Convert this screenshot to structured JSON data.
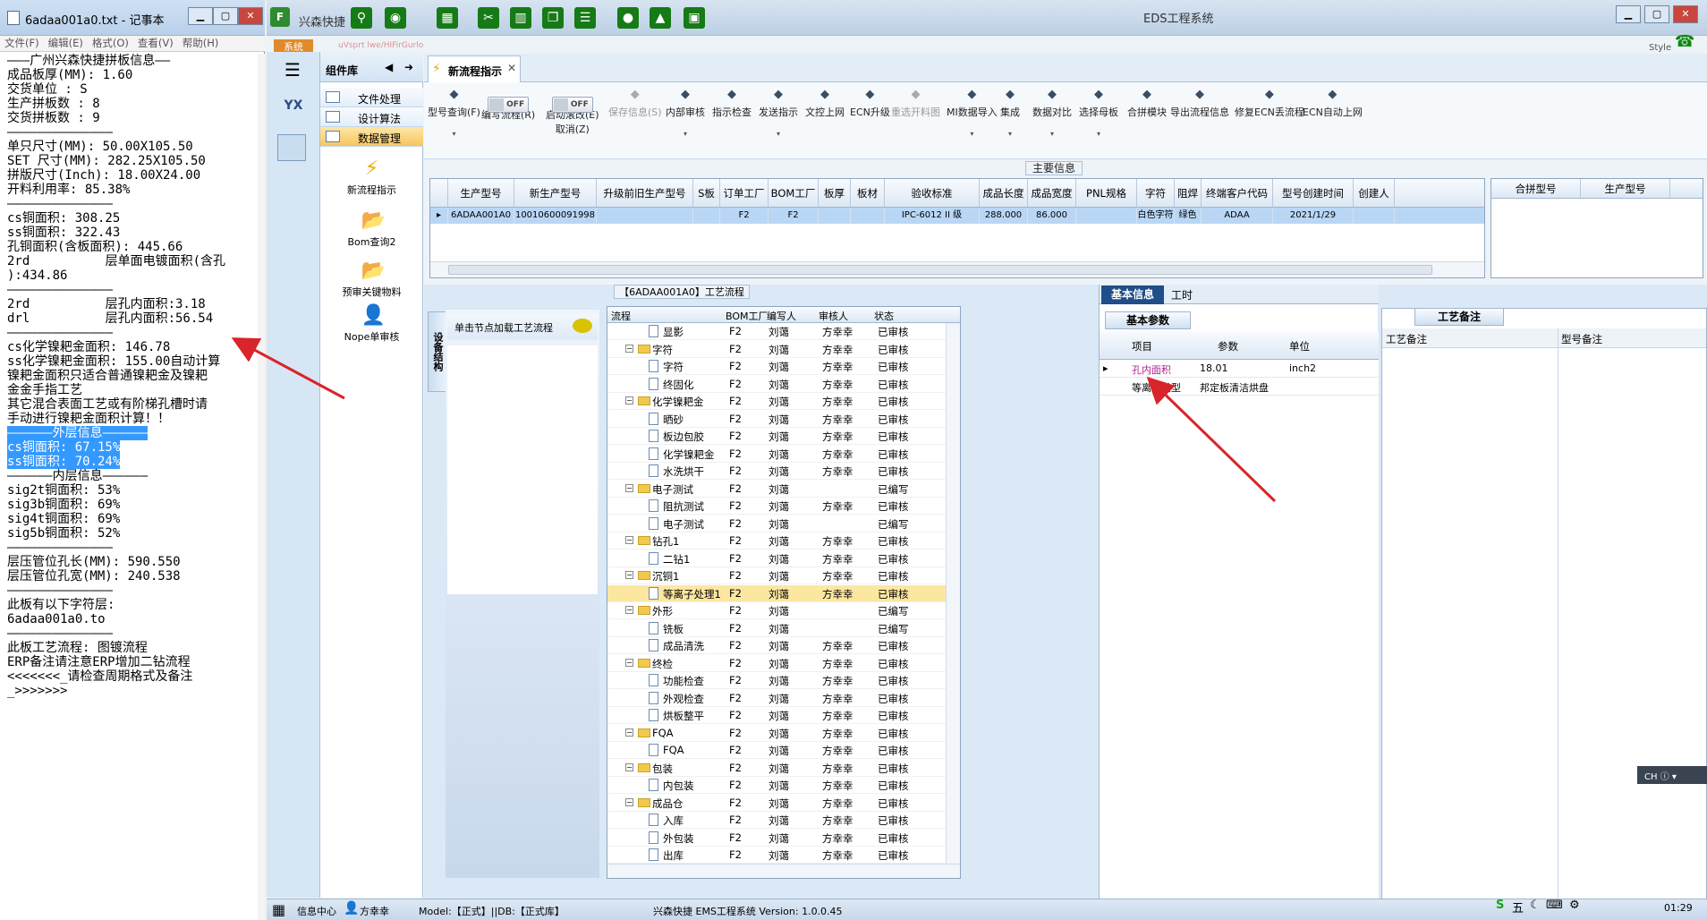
{
  "notepad": {
    "title": "6adaa001a0.txt - 记事本",
    "menu": [
      "文件(F)",
      "编辑(E)",
      "格式(O)",
      "查看(V)",
      "帮助(H)"
    ],
    "lines": [
      "———广州兴森快捷拼板信息——",
      "成品板厚(MM): 1.60",
      "交货单位 : S",
      "生产拼板数 : 8",
      "交货拼板数 : 9",
      "——————————————",
      "单只尺寸(MM): 50.00X105.50",
      "SET 尺寸(MM): 282.25X105.50",
      "拼版尺寸(Inch): 18.00X24.00",
      "开料利用率: 85.38%",
      "——————————————",
      "cs铜面积: 308.25",
      "ss铜面积: 322.43",
      "孔铜面积(含板面积): 445.66",
      "2rd          层单面电镀面积(含孔",
      "):434.86",
      "",
      "——————————————",
      "2rd          层孔内面积:3.18",
      "drl          层孔内面积:56.54",
      "",
      "——————————————",
      "cs化学镍耙金面积: 146.78",
      "ss化学镍耙金面积: 155.00自动计算",
      "镍耙金面积只适合普通镍耙金及镍耙",
      "金金手指工艺",
      "其它混合表面工艺或有阶梯孔槽时请",
      "手动进行镍耙金面积计算！！",
      "——————外层信息——————",
      "cs铜面积: 67.15%",
      "ss铜面积: 70.24%",
      "——————内层信息——————",
      "sig2t铜面积: 53%",
      "sig3b铜面积: 69%",
      "sig4t铜面积: 69%",
      "sig5b铜面积: 52%",
      "——————————————",
      "层压管位孔长(MM): 590.550",
      "层压管位孔宽(MM): 240.538",
      "",
      "——————————————",
      "此板有以下字符层:",
      "6adaa001a0.to",
      "——————————————",
      "此板工艺流程: 图镀流程",
      "ERP备注请注意ERP增加二钻流程",
      "<<<<<<<_请检查周期格式及备注",
      "_>>>>>>>"
    ]
  },
  "app": {
    "name": "兴森快捷",
    "title": "EDS工程系统",
    "system_tab": "系统",
    "style_label": "Style",
    "blur_text": "uVsprt  lwe/HIFirGurlo"
  },
  "nav": {
    "component_header": "组件库",
    "buttons": [
      "文件处理",
      "设计算法",
      "数据管理"
    ],
    "items": [
      "新流程指示",
      "Bom查询2",
      "预审关键物料",
      "Nope单审核"
    ]
  },
  "tab": {
    "label": "新流程指示"
  },
  "toolbar": {
    "items": [
      {
        "label": "型号查询(F)",
        "icon": "search-icon"
      },
      {
        "label": "编写流程(R)",
        "icon": "toggle"
      },
      {
        "label": "启动滚改(E)",
        "label2": "取消(Z)",
        "icon": "toggle"
      },
      {
        "label": "保存信息(S)",
        "icon": "check-icon"
      },
      {
        "label": "内部审核",
        "icon": "print-icon"
      },
      {
        "label": "指示检查",
        "icon": "checkbox-icon"
      },
      {
        "label": "发送指示",
        "icon": "upload-icon"
      },
      {
        "label": "文控上网",
        "icon": "cloud-icon"
      },
      {
        "label": "ECN升级",
        "icon": "arrow-up-icon"
      },
      {
        "label": "重选开料图",
        "icon": "image-icon"
      },
      {
        "label": "MI数据导入",
        "icon": "import-icon"
      },
      {
        "label": "集成",
        "icon": "download-icon"
      },
      {
        "label": "数据对比",
        "icon": "compare-icon"
      },
      {
        "label": "选择母板",
        "icon": "shuffle-icon"
      },
      {
        "label": "合拼模块",
        "icon": "list-icon"
      },
      {
        "label": "导出流程信息",
        "icon": "smile-icon"
      },
      {
        "label": "修复ECN丢流程",
        "icon": "wrench-icon"
      },
      {
        "label": "ECN自动上网",
        "icon": "star-icon"
      }
    ],
    "toggle_text": "OFF"
  },
  "main_info": {
    "caption": "主要信息",
    "headers": [
      "生产型号",
      "新生产型号",
      "升级前旧生产型号",
      "S板",
      "订单工厂",
      "BOM工厂",
      "板厚",
      "板材",
      "验收标准",
      "成品长度",
      "成品宽度",
      "PNL规格",
      "字符",
      "阻焊",
      "终端客户代码",
      "型号创建时间",
      "创建人"
    ],
    "row": [
      "6ADAA001A0",
      "10010600091998",
      "",
      "",
      "F2",
      "F2",
      "",
      "",
      "IPC-6012 II 级",
      "288.000",
      "86.000",
      "",
      "白色字符",
      "绿色",
      "ADAA",
      "2021/1/29",
      ""
    ],
    "side_headers": [
      "合拼型号",
      "生产型号"
    ]
  },
  "node_panel": {
    "side_tab": "设备结构",
    "hint": "单击节点加载工艺流程"
  },
  "flow": {
    "caption": "【6ADAA001A0】工艺流程",
    "headers": [
      "流程",
      "BOM工厂",
      "编写人",
      "审核人",
      "状态"
    ],
    "rows": [
      {
        "level": 2,
        "name": "显影",
        "bom": "F2",
        "writer": "刘蔼",
        "reviewer": "方幸幸",
        "status": "已审核"
      },
      {
        "level": 1,
        "name": "字符",
        "bom": "F2",
        "writer": "刘蔼",
        "reviewer": "方幸幸",
        "status": "已审核"
      },
      {
        "level": 2,
        "name": "字符",
        "bom": "F2",
        "writer": "刘蔼",
        "reviewer": "方幸幸",
        "status": "已审核"
      },
      {
        "level": 2,
        "name": "终固化",
        "bom": "F2",
        "writer": "刘蔼",
        "reviewer": "方幸幸",
        "status": "已审核"
      },
      {
        "level": 1,
        "name": "化学镍耙金",
        "bom": "F2",
        "writer": "刘蔼",
        "reviewer": "方幸幸",
        "status": "已审核"
      },
      {
        "level": 2,
        "name": "晒砂",
        "bom": "F2",
        "writer": "刘蔼",
        "reviewer": "方幸幸",
        "status": "已审核"
      },
      {
        "level": 2,
        "name": "板边包胶",
        "bom": "F2",
        "writer": "刘蔼",
        "reviewer": "方幸幸",
        "status": "已审核"
      },
      {
        "level": 2,
        "name": "化学镍耙金",
        "bom": "F2",
        "writer": "刘蔼",
        "reviewer": "方幸幸",
        "status": "已审核"
      },
      {
        "level": 2,
        "name": "水洗烘干",
        "bom": "F2",
        "writer": "刘蔼",
        "reviewer": "方幸幸",
        "status": "已审核"
      },
      {
        "level": 1,
        "name": "电子测试",
        "bom": "F2",
        "writer": "刘蔼",
        "reviewer": "",
        "status": "已编写"
      },
      {
        "level": 2,
        "name": "阻抗测试",
        "bom": "F2",
        "writer": "刘蔼",
        "reviewer": "方幸幸",
        "status": "已审核"
      },
      {
        "level": 2,
        "name": "电子测试",
        "bom": "F2",
        "writer": "刘蔼",
        "reviewer": "",
        "status": "已编写"
      },
      {
        "level": 1,
        "name": "钻孔1",
        "bom": "F2",
        "writer": "刘蔼",
        "reviewer": "方幸幸",
        "status": "已审核"
      },
      {
        "level": 2,
        "name": "二钻1",
        "bom": "F2",
        "writer": "刘蔼",
        "reviewer": "方幸幸",
        "status": "已审核"
      },
      {
        "level": 1,
        "name": "沉铜1",
        "bom": "F2",
        "writer": "刘蔼",
        "reviewer": "方幸幸",
        "status": "已审核"
      },
      {
        "level": 2,
        "name": "等离子处理1",
        "bom": "F2",
        "writer": "刘蔼",
        "reviewer": "方幸幸",
        "status": "已审核",
        "selected": true
      },
      {
        "level": 1,
        "name": "外形",
        "bom": "F2",
        "writer": "刘蔼",
        "reviewer": "",
        "status": "已编写"
      },
      {
        "level": 2,
        "name": "铣板",
        "bom": "F2",
        "writer": "刘蔼",
        "reviewer": "",
        "status": "已编写"
      },
      {
        "level": 2,
        "name": "成品清洗",
        "bom": "F2",
        "writer": "刘蔼",
        "reviewer": "方幸幸",
        "status": "已审核"
      },
      {
        "level": 1,
        "name": "终检",
        "bom": "F2",
        "writer": "刘蔼",
        "reviewer": "方幸幸",
        "status": "已审核"
      },
      {
        "level": 2,
        "name": "功能检查",
        "bom": "F2",
        "writer": "刘蔼",
        "reviewer": "方幸幸",
        "status": "已审核"
      },
      {
        "level": 2,
        "name": "外观检查",
        "bom": "F2",
        "writer": "刘蔼",
        "reviewer": "方幸幸",
        "status": "已审核"
      },
      {
        "level": 2,
        "name": "烘板整平",
        "bom": "F2",
        "writer": "刘蔼",
        "reviewer": "方幸幸",
        "status": "已审核"
      },
      {
        "level": 1,
        "name": "FQA",
        "bom": "F2",
        "writer": "刘蔼",
        "reviewer": "方幸幸",
        "status": "已审核"
      },
      {
        "level": 2,
        "name": "FQA",
        "bom": "F2",
        "writer": "刘蔼",
        "reviewer": "方幸幸",
        "status": "已审核"
      },
      {
        "level": 1,
        "name": "包装",
        "bom": "F2",
        "writer": "刘蔼",
        "reviewer": "方幸幸",
        "status": "已审核"
      },
      {
        "level": 2,
        "name": "内包装",
        "bom": "F2",
        "writer": "刘蔼",
        "reviewer": "方幸幸",
        "status": "已审核"
      },
      {
        "level": 1,
        "name": "成品仓",
        "bom": "F2",
        "writer": "刘蔼",
        "reviewer": "方幸幸",
        "status": "已审核"
      },
      {
        "level": 2,
        "name": "入库",
        "bom": "F2",
        "writer": "刘蔼",
        "reviewer": "方幸幸",
        "status": "已审核"
      },
      {
        "level": 2,
        "name": "外包装",
        "bom": "F2",
        "writer": "刘蔼",
        "reviewer": "方幸幸",
        "status": "已审核"
      },
      {
        "level": 2,
        "name": "出库",
        "bom": "F2",
        "writer": "刘蔼",
        "reviewer": "方幸幸",
        "status": "已审核"
      }
    ]
  },
  "basic": {
    "tabs": [
      "基本信息",
      "工时"
    ],
    "caption": "基本参数",
    "headers": [
      "项目",
      "参数",
      "单位"
    ],
    "rows": [
      {
        "item": "孔内面积",
        "param": "18.01",
        "unit": "inch2",
        "item_color": "#b0208a"
      },
      {
        "item": "等离子类型",
        "param": "邦定板清洁烘盘",
        "unit": ""
      }
    ]
  },
  "remark": {
    "caption": "工艺备注",
    "headers": [
      "工艺备注",
      "型号备注"
    ]
  },
  "status": {
    "info_center": "信息中心",
    "user": "方幸幸",
    "model": "Model:【正式】||DB:【正式库】",
    "version": "兴森快捷  EMS工程系统 Version: 1.0.0.45"
  },
  "ime": {
    "label": "CH"
  },
  "tray": {
    "ime_mode": "五",
    "time": "01:29"
  },
  "colors": {
    "accent": "#1f4e88",
    "selection": "#b9d7f5",
    "highlight_row": "#fce7a0",
    "arrow": "#d8242a"
  }
}
